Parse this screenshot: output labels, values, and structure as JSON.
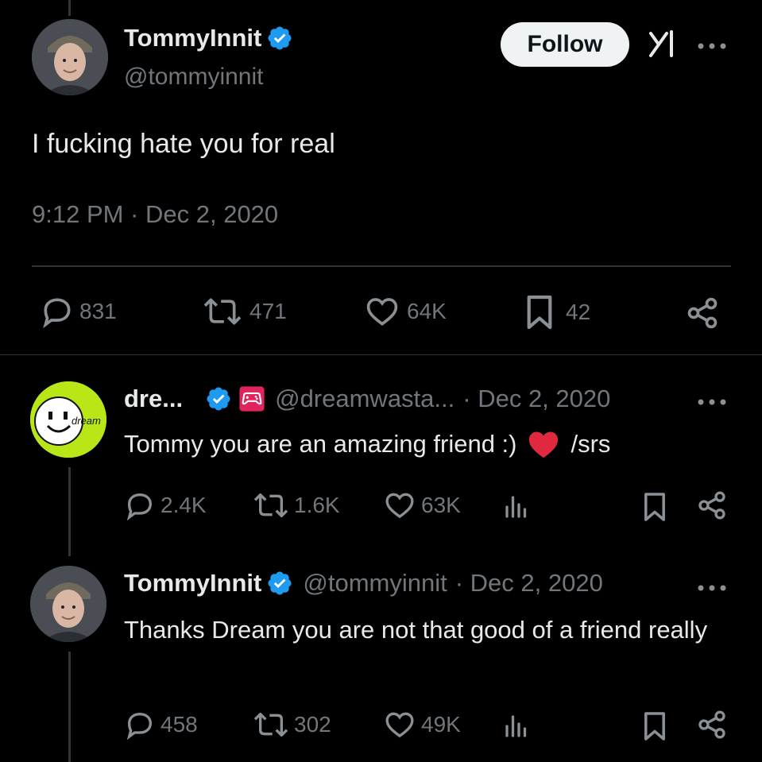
{
  "main_tweet": {
    "display_name": "TommyInnit",
    "handle": "@tommyinnit",
    "follow_label": "Follow",
    "text": "I fucking hate you for real",
    "timestamp": "9:12 PM · Dec 2, 2020",
    "stats": {
      "replies": "831",
      "retweets": "471",
      "likes": "64K",
      "bookmarks": "42"
    }
  },
  "reply_1": {
    "display_name": "dre...",
    "handle": "@dreamwasta...",
    "date": "· Dec 2, 2020",
    "text": "Tommy you are an amazing friend :)",
    "text_suffix": "/srs",
    "avatar_label": "dream",
    "stats": {
      "replies": "2.4K",
      "retweets": "1.6K",
      "likes": "63K"
    }
  },
  "reply_2": {
    "display_name": "TommyInnit",
    "handle": "@tommyinnit",
    "date": "· Dec 2, 2020",
    "text": "Thanks Dream you are not that good of a friend really",
    "stats": {
      "replies": "458",
      "retweets": "302",
      "likes": "49K"
    }
  },
  "colors": {
    "verified": "#1d9bf0",
    "heart": "#f91880",
    "muted": "#71767b",
    "dream_green": "#b8e617"
  }
}
